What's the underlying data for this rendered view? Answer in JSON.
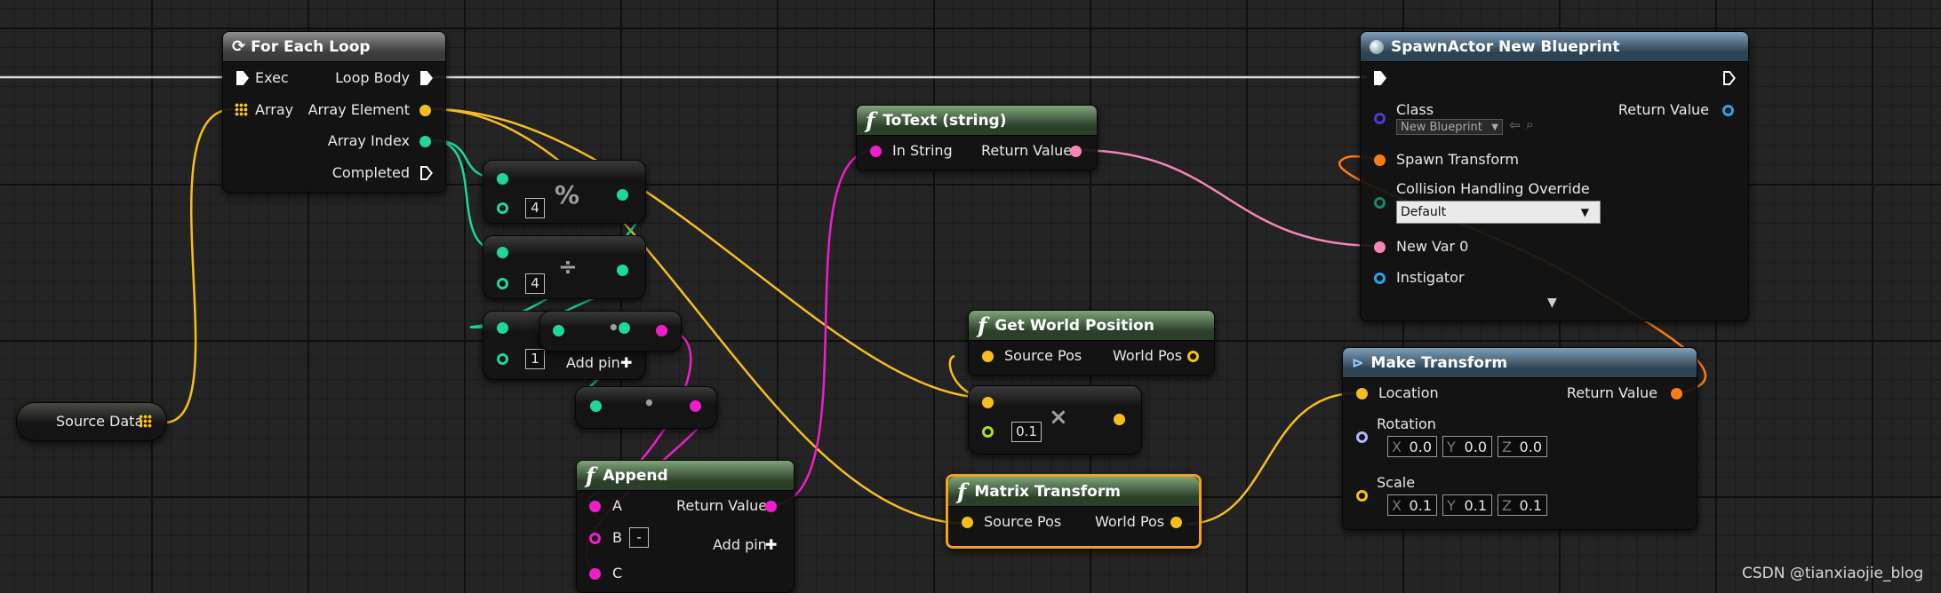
{
  "nodes": {
    "for_each_loop": {
      "title": "For Each Loop",
      "exec_in": "Exec",
      "loop_body": "Loop Body",
      "array": "Array",
      "array_element": "Array Element",
      "array_index": "Array Index",
      "completed": "Completed"
    },
    "source_data": {
      "label": "Source Data"
    },
    "modulo": {
      "symbol": "%",
      "value": "4"
    },
    "divide": {
      "symbol": "÷",
      "value": "4"
    },
    "add": {
      "symbol": "+",
      "value": "1",
      "add_pin": "Add pin"
    },
    "multiply_int": {
      "symbol": "•"
    },
    "append": {
      "title": "Append",
      "a": "A",
      "b": "B",
      "b_value": "-",
      "c": "C",
      "return_value": "Return Value",
      "add_pin": "Add pin"
    },
    "to_text": {
      "title": "ToText (string)",
      "in_string": "In String",
      "return_value": "Return Value"
    },
    "get_world_position": {
      "title": "Get World Position",
      "source_pos": "Source Pos",
      "world_pos": "World Pos"
    },
    "multiply_float": {
      "symbol": "×",
      "value": "0.1"
    },
    "matrix_transform": {
      "title": "Matrix Transform",
      "source_pos": "Source Pos",
      "world_pos": "World Pos"
    },
    "spawn_actor": {
      "title": "SpawnActor New Blueprint",
      "class": "Class",
      "class_value": "New Blueprint",
      "return_value": "Return Value",
      "spawn_transform": "Spawn Transform",
      "collision": "Collision Handling Override",
      "collision_value": "Default",
      "new_var": "New Var 0",
      "instigator": "Instigator",
      "expand": "▼"
    },
    "make_transform": {
      "title": "Make Transform",
      "location": "Location",
      "return_value": "Return Value",
      "rotation": "Rotation",
      "rotation_x": "0.0",
      "rotation_y": "0.0",
      "rotation_z": "0.0",
      "scale": "Scale",
      "scale_x": "0.1",
      "scale_y": "0.1",
      "scale_z": "0.1"
    }
  },
  "axis_labels": {
    "x": "X",
    "y": "Y",
    "z": "Z"
  },
  "plus": "✚",
  "watermark": "CSDN @tianxiaojie_blog",
  "colors": {
    "exec": "#ffffff",
    "vector": "#f5be1e",
    "integer": "#1ed79b",
    "string": "#f01ec8",
    "text": "#f585b9",
    "transform": "#ff7b14",
    "selected": "#f2a21c"
  },
  "icons": {
    "loop": "loop-icon",
    "function": "function-icon",
    "array": "array-grid-icon",
    "spawn": "spawn-icon",
    "make": "make-struct-icon"
  }
}
